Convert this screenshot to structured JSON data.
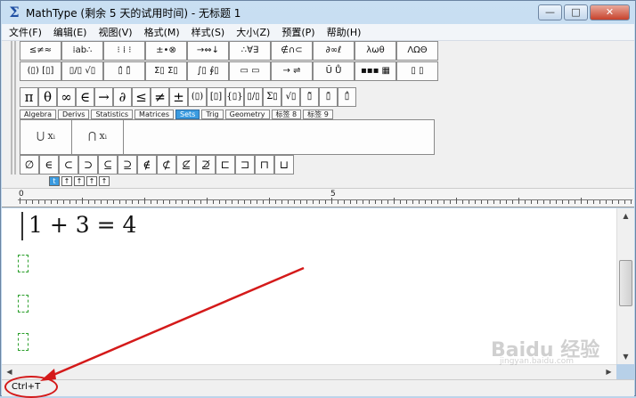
{
  "titlebar": {
    "title": "MathType (剩余 5 天的试用时间) - 无标题 1",
    "icon_glyph": "Σ",
    "minimize": "—",
    "maximize": "□",
    "close": "✕"
  },
  "menu": [
    "文件(F)",
    "编辑(E)",
    "视图(V)",
    "格式(M)",
    "样式(S)",
    "大小(Z)",
    "预置(P)",
    "帮助(H)"
  ],
  "palette_row1": [
    "≤≠≈",
    "⁞ab∴",
    "⁝ ⁞ ⁝",
    "±•⊗",
    "→⇔↓",
    "∴∀∃",
    "∉∩⊂",
    "∂∞ℓ",
    "λωθ",
    "ΛΩΘ"
  ],
  "palette_row2": [
    "(▯) [▯]",
    "▯/▯ √▯",
    "▯̂ ▯̄",
    "Σ▯ Σ▯",
    "∫▯ ∮▯",
    "▭ ▭",
    "→ ⇌",
    "Ū Ů",
    "▪▪▪ ▦",
    "▯ ▯"
  ],
  "palette_row3": [
    "π",
    "θ",
    "∞",
    "∈",
    "→",
    "∂",
    "≤",
    "≠",
    "±",
    "(▯)",
    "[▯]",
    "{▯}",
    "▯/▯",
    "Σ▯",
    "√▯",
    "▯̃",
    "▯̄",
    "▯̂"
  ],
  "tabs": [
    "Algebra",
    "Derivs",
    "Statistics",
    "Matrices",
    "Sets",
    "Trig",
    "Geometry",
    "标签 8",
    "标签 9"
  ],
  "active_tab": "Sets",
  "templates": [
    "⋃ xᵢ",
    "⋂ xᵢ"
  ],
  "palette_row5": [
    "∅",
    "∈",
    "⊂",
    "⊃",
    "⊆",
    "⊇",
    "∉",
    "⊄",
    "⊈",
    "⊉",
    "⊏",
    "⊐",
    "⊓",
    "⊔"
  ],
  "style_buttons": [
    "t",
    "↑",
    "↑",
    "↑",
    "↑"
  ],
  "ruler": {
    "left_label": "0",
    "mid_label": "5"
  },
  "editor": {
    "equation": "1 + 3 = 4"
  },
  "status": {
    "text": "Ctrl+T"
  },
  "watermark": {
    "main": "Baidu 经验",
    "sub": "jingyan.baidu.com"
  },
  "colors": {
    "accent": "#3a9be0",
    "annotation": "#d41a1a",
    "placeholder": "#2ea02e"
  }
}
